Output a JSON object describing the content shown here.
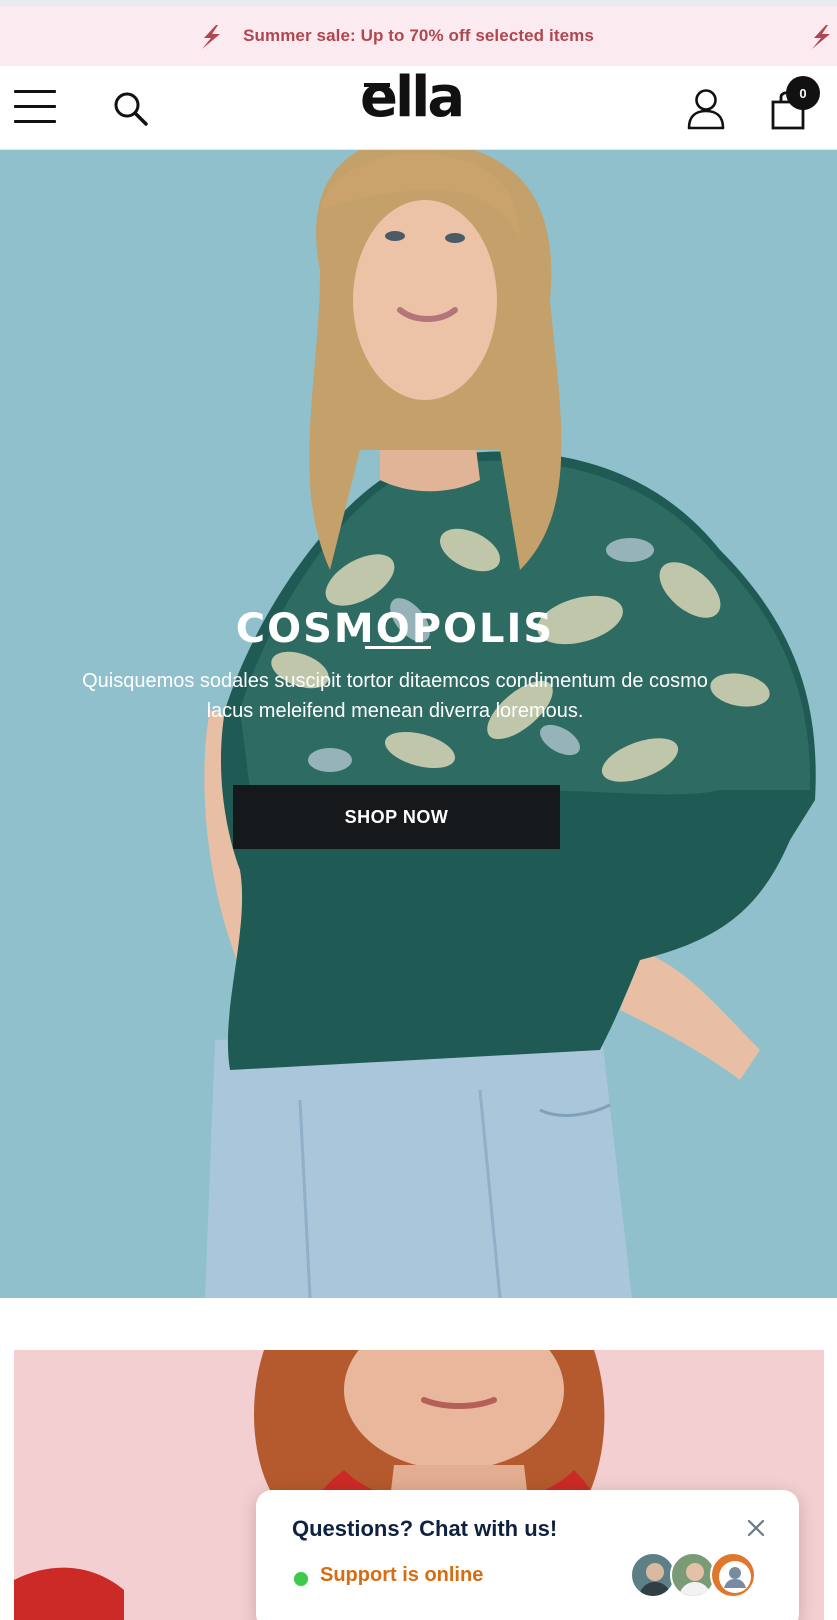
{
  "announcement": {
    "text": "Summer sale: Up to 70% off selected items",
    "icon": "lightning-bolt-icon",
    "color": "#b0474f",
    "background": "#fbeaf0"
  },
  "header": {
    "logo": "ella",
    "cart_count": "0",
    "icons": [
      "menu-icon",
      "search-icon",
      "account-icon",
      "cart-icon"
    ]
  },
  "hero": {
    "title": "COSMOPOLIS",
    "description": "Quisquemos sodales suscipit tortor ditaemcos condimentum de cosmo lacus meleifend menean diverra loremous.",
    "button_label": "SHOP NOW",
    "background": "#8fc0cc"
  },
  "chat_widget": {
    "heading": "Questions? Chat with us!",
    "status": "Support is online",
    "status_color": "#d86c11",
    "online_color": "#3ccb4b"
  }
}
